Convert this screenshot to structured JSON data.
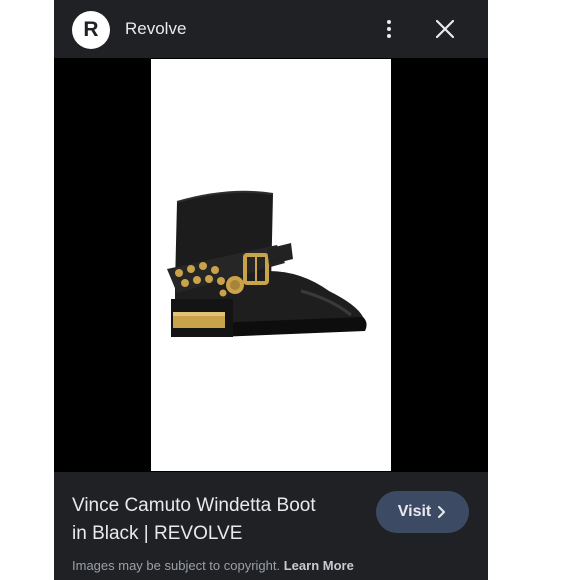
{
  "header": {
    "logo_letter": "R",
    "site_name": "Revolve",
    "more_icon": "more-vert-icon",
    "close_icon": "close-icon"
  },
  "image": {
    "subject": "black ankle boot with gold studs and buckle strap"
  },
  "info": {
    "title_line1": "Vince Camuto Windetta Boot",
    "title_line2": "in Black | REVOLVE",
    "visit_label": "Visit",
    "visit_icon": "chevron-right-icon",
    "copyright_text": "Images may be subject to copyright.",
    "learn_more_label": "Learn More"
  },
  "colors": {
    "topbar_bg": "#202124",
    "visit_button_bg": "#3c4a63",
    "text_primary": "#e8eaed",
    "text_secondary": "#9aa0a6",
    "boot_black": "#1c1c1c",
    "boot_gold": "#c9a24a"
  }
}
